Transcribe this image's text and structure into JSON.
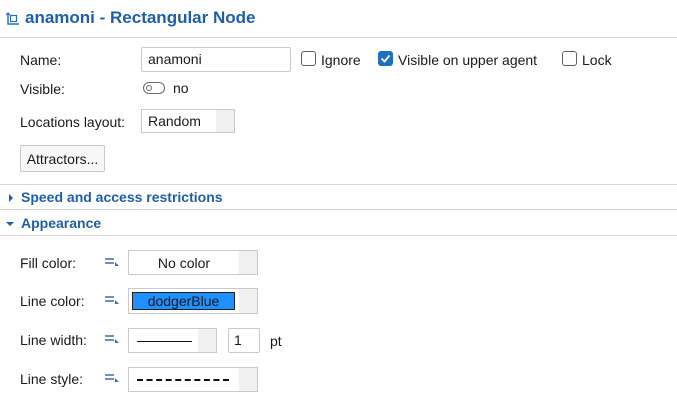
{
  "header": {
    "title": "anamoni - Rectangular Node",
    "icon": "node-icon"
  },
  "properties": {
    "name_label": "Name:",
    "name_value": "anamoni",
    "ignore_label": "Ignore",
    "ignore_checked": false,
    "visible_upper_label": "Visible on upper agent",
    "visible_upper_checked": true,
    "lock_label": "Lock",
    "lock_checked": false,
    "visible_label": "Visible:",
    "visible_value": "no",
    "locations_layout_label": "Locations layout:",
    "locations_layout_value": "Random",
    "attractors_button": "Attractors..."
  },
  "sections": {
    "speed_title": "Speed and access restrictions",
    "appearance_title": "Appearance"
  },
  "appearance": {
    "fill_color_label": "Fill color:",
    "fill_color_value": "No color",
    "line_color_label": "Line color:",
    "line_color_value": "dodgerBlue",
    "line_color_hex": "#1e90ff",
    "line_width_label": "Line width:",
    "line_width_value": "1",
    "line_width_unit": "pt",
    "line_style_label": "Line style:"
  },
  "colors": {
    "accent": "#1f5fa8",
    "checkbox": "#1d6fbf"
  }
}
